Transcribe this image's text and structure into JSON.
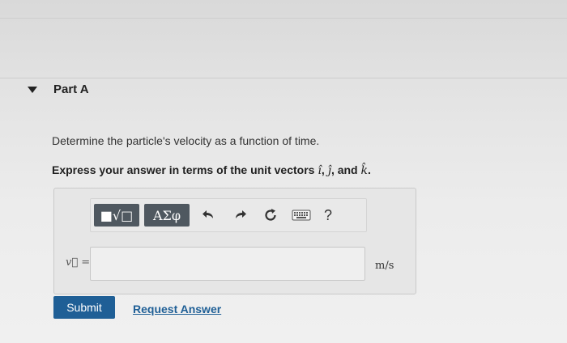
{
  "part": {
    "title": "Part A"
  },
  "question": {
    "text": "Determine the particle's velocity as a function of time.",
    "instruction_prefix": "Express your answer in terms of the unit vectors ",
    "unit_vectors": [
      "î",
      "ĵ",
      "k̂"
    ],
    "separator_1": ", ",
    "separator_2": ", and ",
    "instruction_suffix": "."
  },
  "toolbar": {
    "templates_label": "■√□",
    "greek_label": "ΑΣφ",
    "help_label": "?",
    "icons": [
      "templates-icon",
      "greek-icon",
      "undo-icon",
      "redo-icon",
      "reset-icon",
      "keyboard-icon",
      "help-icon"
    ]
  },
  "answer": {
    "variable_label": "v⃗ =",
    "value": "",
    "unit": "m/s"
  },
  "actions": {
    "submit_label": "Submit",
    "request_label": "Request Answer"
  },
  "colors": {
    "primary": "#1f5f96",
    "toolbar_dark": "#4f5860"
  }
}
